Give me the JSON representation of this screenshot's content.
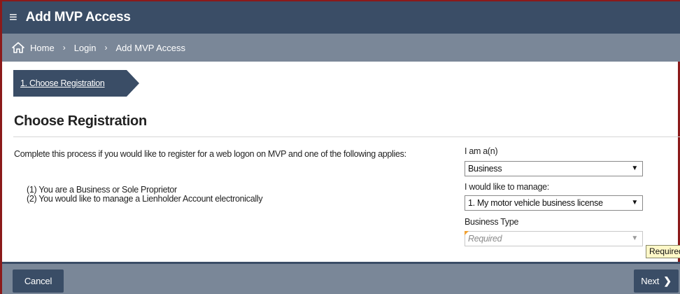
{
  "header": {
    "menu_icon": "hamburger-icon",
    "title": "Add MVP Access"
  },
  "breadcrumb": {
    "home_icon": "home-icon",
    "items": [
      "Home",
      "Login",
      "Add MVP Access"
    ],
    "separator": "›"
  },
  "steps": [
    {
      "label": "1. Choose Registration"
    }
  ],
  "main": {
    "section_title": "Choose Registration",
    "description": "Complete this process if you would like to register for a web logon on MVP and one of the following applies:",
    "conditions": [
      "(1) You are a Business or Sole Proprietor",
      "(2) You would like to manage a Lienholder Account electronically"
    ]
  },
  "form": {
    "i_am_label": "I am a(n)",
    "i_am_value": "Business",
    "manage_label": "I would like to manage:",
    "manage_value": "1. My motor vehicle business license",
    "business_type_label": "Business Type",
    "business_type_placeholder": "Required",
    "tooltip": "Required"
  },
  "footer": {
    "cancel_label": "Cancel",
    "next_label": "Next",
    "next_icon": "chevron-right-icon"
  },
  "colors": {
    "header_bg": "#3a4d66",
    "breadcrumb_bg": "#7a8798",
    "window_border": "#8b1a1a",
    "required_marker": "#f0a030"
  }
}
